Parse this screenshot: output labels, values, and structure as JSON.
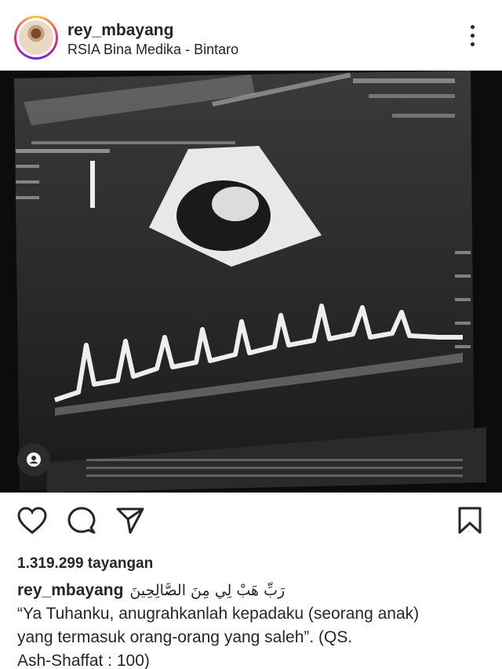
{
  "post": {
    "username": "rey_mbayang",
    "location": "RSIA Bina Medika - Bintaro",
    "views": "1.319.299 tayangan",
    "caption_arabic": "رَبِّ هَبْ لِي مِنَ الصَّالِحِينَ",
    "caption_line1": "“Ya Tuhanku, anugrahkanlah kepadaku (seorang anak)",
    "caption_line2": "yang termasuk orang-orang yang saleh”. (QS.",
    "caption_line3": "Ash-Shaffat : 100)"
  },
  "icons": {
    "more": "more-vertical-icon",
    "like": "heart-icon",
    "comment": "comment-icon",
    "share": "send-icon",
    "save": "bookmark-icon",
    "tags": "user-tag-icon"
  },
  "colors": {
    "text": "#262626",
    "media_bg": "#101010"
  }
}
